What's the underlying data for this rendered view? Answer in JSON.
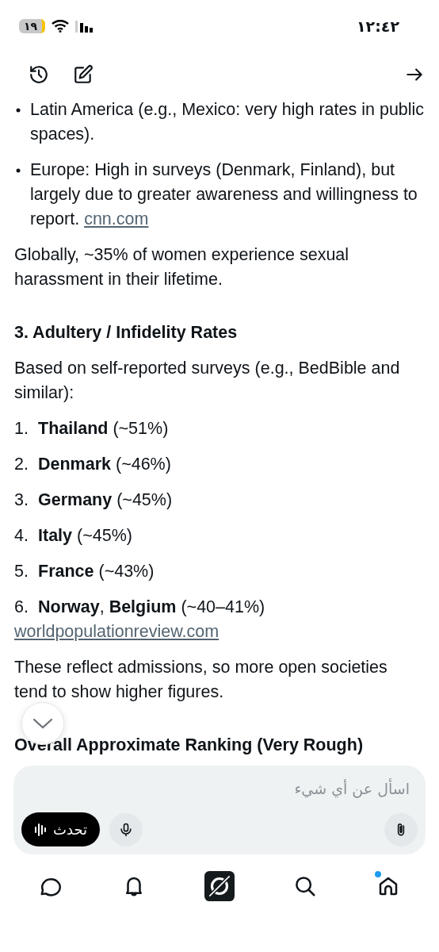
{
  "status_bar": {
    "time": "١٢:٤٢",
    "battery": "١٩"
  },
  "toolbar": {
    "actions": [
      {
        "kind": "history"
      },
      {
        "kind": "edit"
      }
    ],
    "forward": {
      "kind": "arrow"
    }
  },
  "content": [
    {
      "kind": "bullet",
      "text": "Latin America (e.g., Mexico: very high rates in public spaces)."
    },
    {
      "kind": "bullet",
      "text": "Europe: High in surveys (Denmark, Finland), but largely due to greater awareness and willingness to report.",
      "link": "cnn.com"
    },
    {
      "kind": "paragraph",
      "text": "Globally, ~35% of women experience sexual harassment in their lifetime."
    },
    {
      "kind": "heading",
      "text": "3. Adultery / Infidelity Rates"
    },
    {
      "kind": "paragraph",
      "text": "Based on self-reported surveys (e.g., BedBible and similar):"
    },
    {
      "kind": "numbered",
      "number": "1.",
      "text": "**Thailand** (~51%)"
    },
    {
      "kind": "numbered",
      "number": "2.",
      "text": "**Denmark** (~46%)"
    },
    {
      "kind": "numbered",
      "number": "3.",
      "text": "**Germany** (~45%)"
    },
    {
      "kind": "numbered",
      "number": "4.",
      "text": "**Italy** (~45%)"
    },
    {
      "kind": "numbered",
      "number": "5.",
      "text": "**France** (~43%)"
    },
    {
      "kind": "numbered",
      "number": "6.",
      "text": "**Norway**, **Belgium** (~40–41%)",
      "link": "worldpopulationreview.com"
    },
    {
      "kind": "paragraph",
      "text": "These reflect admissions, so more open societies tend to show higher figures."
    },
    {
      "kind": "heading",
      "text": "Overall Approximate Ranking (Very Rough)"
    }
  ],
  "composer": {
    "placeholder": "اسأل عن أي شيء",
    "talk_button": "تحدث"
  },
  "nav": [
    {
      "kind": "chat",
      "dot": false
    },
    {
      "kind": "bell",
      "dot": false
    },
    {
      "kind": "logo",
      "dot": false
    },
    {
      "kind": "search",
      "dot": false
    },
    {
      "kind": "home",
      "dot": true
    }
  ]
}
